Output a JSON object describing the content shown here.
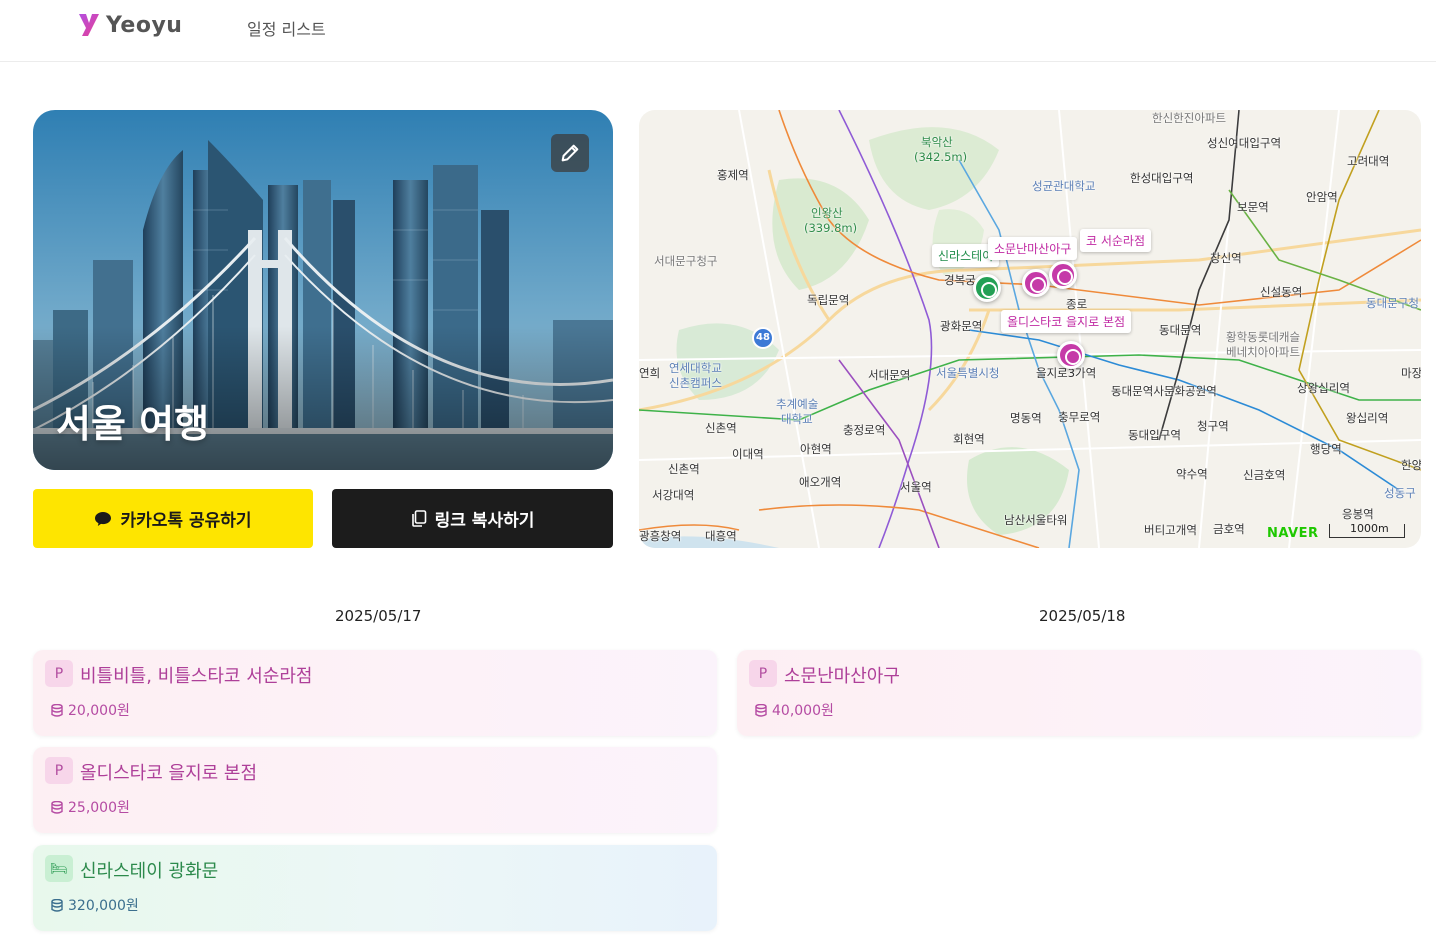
{
  "header": {
    "logo_text": "Yeoyu",
    "nav_link": "일정 리스트"
  },
  "hero": {
    "title": "서울 여행",
    "edit_icon": "pencil-icon"
  },
  "share": {
    "kakao_label": "카카오톡 공유하기",
    "kakao_icon": "speech-bubble-icon",
    "link_label": "링크 복사하기",
    "link_icon": "copy-icon"
  },
  "map": {
    "labels": [
      {
        "name": "label-bukaksan",
        "text": "북악산",
        "cls": "green"
      },
      {
        "name": "label-bukaksan-height",
        "text": "(342.5m)",
        "cls": "green"
      },
      {
        "name": "label-hanshin",
        "text": "한신한진아파트",
        "cls": "gray"
      },
      {
        "name": "label-sungshin",
        "text": "성신여대입구역",
        "cls": ""
      },
      {
        "name": "label-korea-univ",
        "text": "고려대역",
        "cls": ""
      },
      {
        "name": "label-hongje",
        "text": "홍제역",
        "cls": ""
      },
      {
        "name": "label-skku",
        "text": "성균관대학교",
        "cls": "blue"
      },
      {
        "name": "label-hansung",
        "text": "한성대입구역",
        "cls": ""
      },
      {
        "name": "label-bomun",
        "text": "보문역",
        "cls": ""
      },
      {
        "name": "label-anam",
        "text": "안암역",
        "cls": ""
      },
      {
        "name": "label-inwangsan",
        "text": "인왕산",
        "cls": "green"
      },
      {
        "name": "label-inwangsan-height",
        "text": "(339.8m)",
        "cls": "green"
      },
      {
        "name": "label-seodaemun-gu",
        "text": "서대문구청구",
        "cls": "gray"
      },
      {
        "name": "label-changsin",
        "text": "창신역",
        "cls": ""
      },
      {
        "name": "label-sinseoldong",
        "text": "신설동역",
        "cls": ""
      },
      {
        "name": "label-dongdaemun-gu",
        "text": "동대문구청",
        "cls": "blue"
      },
      {
        "name": "label-gyeongbokgung",
        "text": "경복궁",
        "cls": ""
      },
      {
        "name": "label-dongnimmun",
        "text": "독립문역",
        "cls": ""
      },
      {
        "name": "label-gwanghwamun",
        "text": "광화문역",
        "cls": ""
      },
      {
        "name": "label-dongdaemun",
        "text": "동대문역",
        "cls": ""
      },
      {
        "name": "label-hwanghak",
        "text": "황학동롯데캐슬",
        "cls": "gray"
      },
      {
        "name": "label-hwanghak2",
        "text": "베네치아아파트",
        "cls": "gray"
      },
      {
        "name": "label-yonsei",
        "text": "연세대학교",
        "cls": "blue"
      },
      {
        "name": "label-yonsei2",
        "text": "신촌캠퍼스",
        "cls": "blue"
      },
      {
        "name": "label-yeonhui",
        "text": "연희",
        "cls": ""
      },
      {
        "name": "label-seodaemun",
        "text": "서대문역",
        "cls": ""
      },
      {
        "name": "label-cityhall",
        "text": "서울특별시청",
        "cls": "blue"
      },
      {
        "name": "label-euljiro3",
        "text": "을지로3가역",
        "cls": ""
      },
      {
        "name": "label-ddp",
        "text": "동대문역사문화공원역",
        "cls": ""
      },
      {
        "name": "label-sangwangsimni",
        "text": "상왕십리역",
        "cls": ""
      },
      {
        "name": "label-masan",
        "text": "마장",
        "cls": ""
      },
      {
        "name": "label-chugye",
        "text": "추계예술",
        "cls": "blue"
      },
      {
        "name": "label-chugye2",
        "text": "대학교",
        "cls": "blue"
      },
      {
        "name": "label-sinchon",
        "text": "신촌역",
        "cls": ""
      },
      {
        "name": "label-chungjeongno",
        "text": "충정로역",
        "cls": ""
      },
      {
        "name": "label-myeongdong",
        "text": "명동역",
        "cls": ""
      },
      {
        "name": "label-chungmuro",
        "text": "충무로역",
        "cls": ""
      },
      {
        "name": "label-dongguk",
        "text": "동대입구역",
        "cls": ""
      },
      {
        "name": "label-cheonggu",
        "text": "청구역",
        "cls": ""
      },
      {
        "name": "label-wangsimni",
        "text": "왕십리역",
        "cls": ""
      },
      {
        "name": "label-hoehyeon",
        "text": "회현역",
        "cls": ""
      },
      {
        "name": "label-ewha",
        "text": "이대역",
        "cls": ""
      },
      {
        "name": "label-ahyeon",
        "text": "아현역",
        "cls": ""
      },
      {
        "name": "label-haengdang",
        "text": "행당역",
        "cls": ""
      },
      {
        "name": "label-sinchon2",
        "text": "신촌역",
        "cls": ""
      },
      {
        "name": "label-yaksu",
        "text": "약수역",
        "cls": ""
      },
      {
        "name": "label-singeumho",
        "text": "신금호역",
        "cls": ""
      },
      {
        "name": "label-hanyang",
        "text": "한양",
        "cls": ""
      },
      {
        "name": "label-seogang",
        "text": "서강대역",
        "cls": ""
      },
      {
        "name": "label-aeogae",
        "text": "애오개역",
        "cls": ""
      },
      {
        "name": "label-seoulstation",
        "text": "서울역",
        "cls": ""
      },
      {
        "name": "label-seongdong",
        "text": "성동구",
        "cls": "blue"
      },
      {
        "name": "label-namsan",
        "text": "남산서울타워",
        "cls": ""
      },
      {
        "name": "label-eungbong",
        "text": "응봉역",
        "cls": ""
      },
      {
        "name": "label-beotigogae",
        "text": "버티고개역",
        "cls": ""
      },
      {
        "name": "label-geumho",
        "text": "금호역",
        "cls": ""
      },
      {
        "name": "label-gwangheungchang",
        "text": "광흥창역",
        "cls": ""
      },
      {
        "name": "label-daeheung",
        "text": "대흥역",
        "cls": ""
      },
      {
        "name": "label-jongno",
        "text": "종로",
        "cls": ""
      }
    ],
    "poi_tags": {
      "shilla_green": "신라스테이",
      "somunnan": "소문난마산아구",
      "bitle": "코 서순라점",
      "olddisco": "올디스타코 을지로 본점"
    },
    "naver_logo": "NAVER",
    "scale_label": "1000m",
    "route_badge": "48"
  },
  "days": [
    {
      "date": "2025/05/17",
      "items": [
        {
          "badge": "P",
          "title": "비틀비틀, 비틀스타코 서순라점",
          "price": "20,000원",
          "type": "place"
        },
        {
          "badge": "P",
          "title": "올디스타코 을지로 본점",
          "price": "25,000원",
          "type": "place"
        },
        {
          "badge": "🛏",
          "title": "신라스테이 광화문",
          "price": "320,000원",
          "type": "stay"
        }
      ]
    },
    {
      "date": "2025/05/18",
      "items": [
        {
          "badge": "P",
          "title": "소문난마산아구",
          "price": "40,000원",
          "type": "place"
        }
      ]
    }
  ],
  "colors": {
    "kakao": "#FEE500",
    "dark_button": "#1c1c1c",
    "place_accent": "#ae3f99",
    "stay_accent": "#2c8a4c",
    "logo_accent": "#d63fa6"
  }
}
